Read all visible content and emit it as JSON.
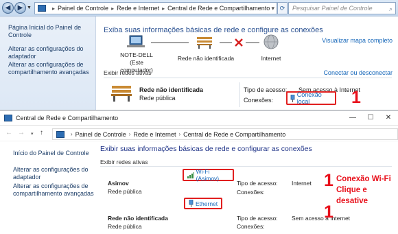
{
  "win7": {
    "breadcrumb": [
      "Painel de Controle",
      "Rede e Internet",
      "Central de Rede e Compartilhamento"
    ],
    "search_placeholder": "Pesquisar Painel de Controle",
    "sidebar": [
      "Página Inicial do Painel de Controle",
      "Alterar as configurações do adaptador",
      "Alterar as configurações de compartilhamento avançadas"
    ],
    "heading": "Exiba suas informações básicas de rede e configure as conexões",
    "map_link": "Visualizar mapa completo",
    "map": {
      "computer_name": "NOTE-DELL",
      "computer_sub": "(Este computador)",
      "network": "Rede não identificada",
      "internet": "Internet"
    },
    "active_networks_label": "Exibir redes ativas",
    "connect_link": "Conectar ou desconectar",
    "network": {
      "name": "Rede não identificada",
      "type": "Rede pública",
      "access_label": "Tipo de acesso:",
      "access_value": "Sem acesso à Internet",
      "connections_label": "Conexões:",
      "connection": "Conexão local"
    },
    "annotation": "1"
  },
  "win10": {
    "title": "Central de Rede e Compartilhamento",
    "breadcrumb": [
      "Painel de Controle",
      "Rede e Internet",
      "Central de Rede e Compartilhamento"
    ],
    "sidebar": [
      "Início do Painel de Controle",
      "Alterar as configurações do adaptador",
      "Alterar as configurações de compartilhamento avançadas"
    ],
    "heading": "Exibir suas informações básicas de rede e configurar as conexões",
    "active_networks_label": "Exibir redes ativas",
    "net1": {
      "name": "Asimov",
      "type": "Rede pública",
      "access_label": "Tipo de acesso:",
      "access_value": "Internet",
      "connections_label": "Conexões:",
      "connection": "Wi-Fi (Asimov)"
    },
    "net2": {
      "name": "Rede não identificada",
      "type": "Rede pública",
      "access_label": "Tipo de acesso:",
      "access_value": "Sem acesso à Internet",
      "connections_label": "Conexões:",
      "connection": "Ethernet"
    },
    "annotation_text_1": "Conexão Wi-Fi",
    "annotation_text_2": "Clique e desative",
    "annotation_number": "1"
  },
  "colors": {
    "link": "#1466b9",
    "heading_w7": "#2b5292",
    "heading_w10": "#1e3287",
    "annotation_red": "#e8101b"
  }
}
